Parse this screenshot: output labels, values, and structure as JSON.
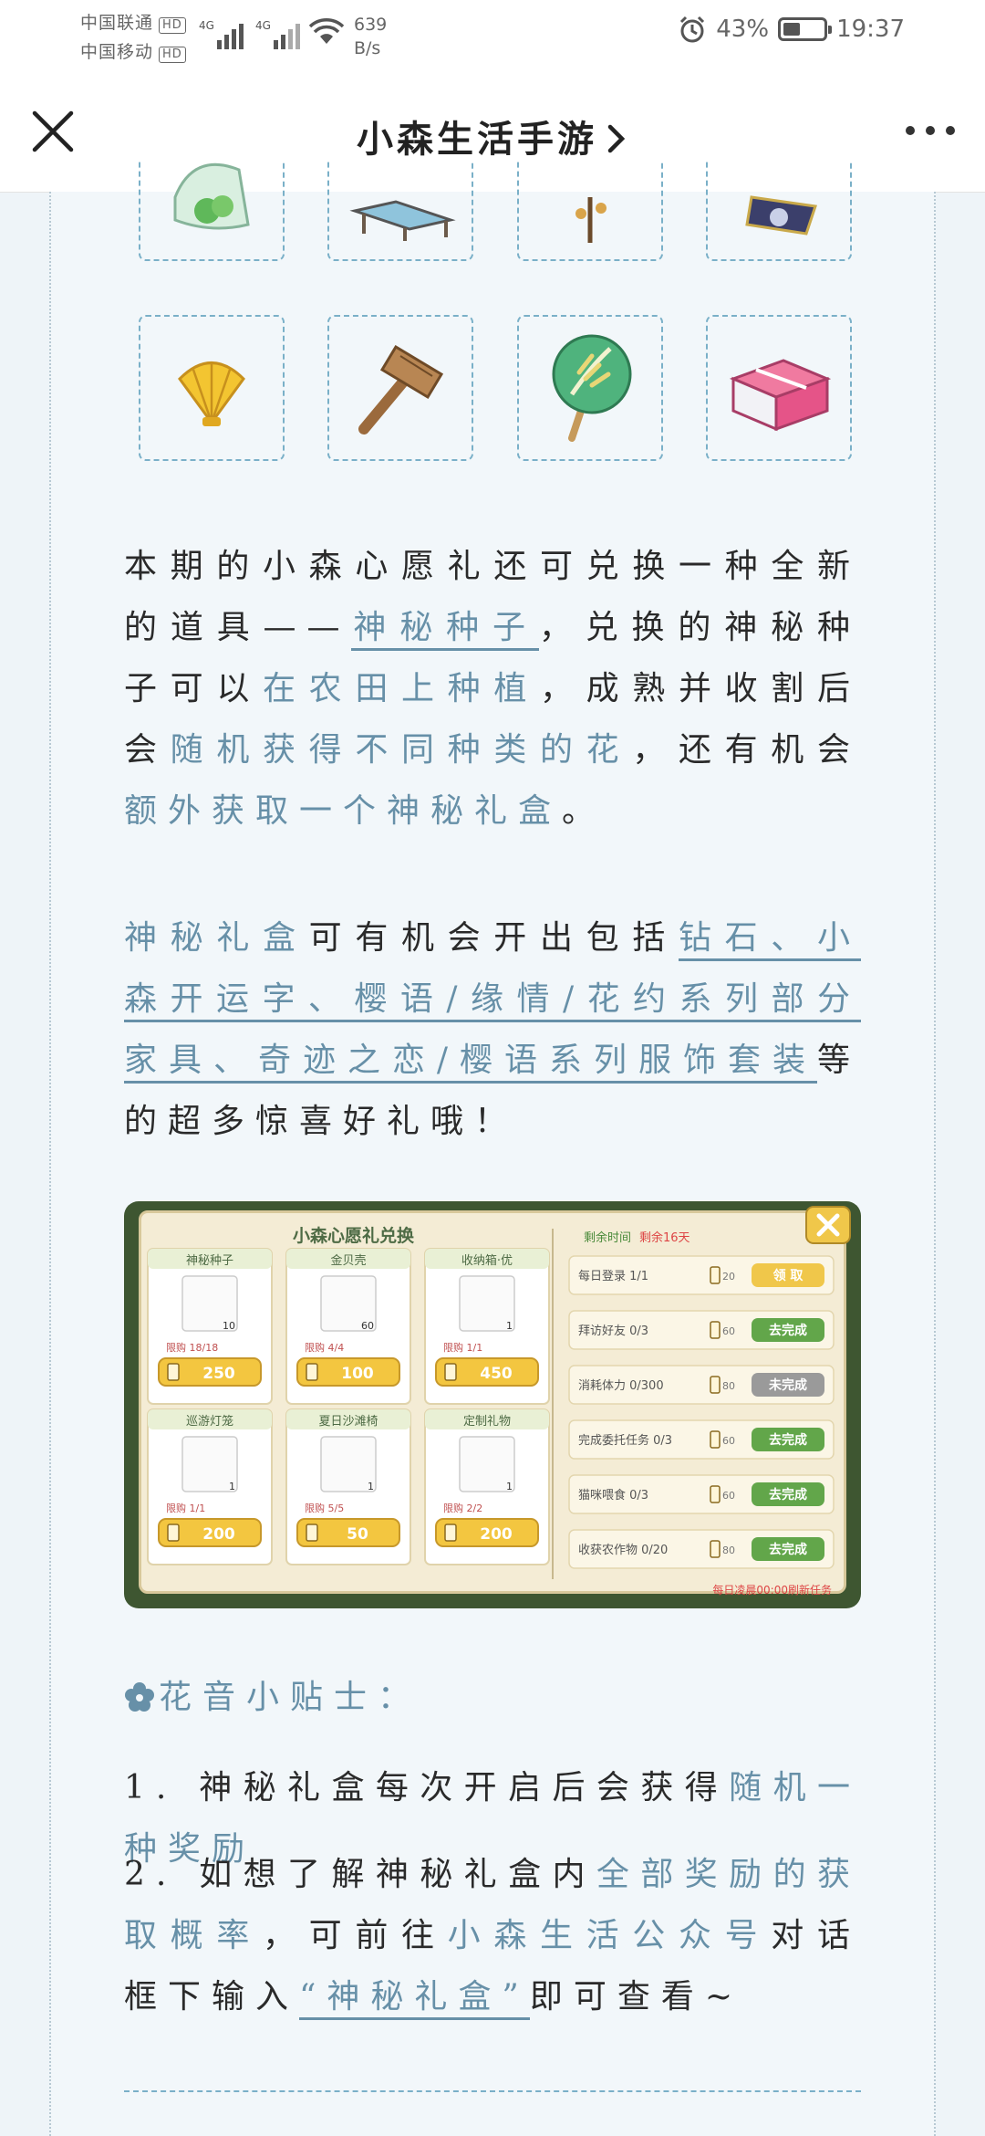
{
  "status": {
    "carrier1": "中国联通",
    "carrier2": "中国移动",
    "hd": "HD",
    "net_speed_value": "639",
    "net_speed_unit": "B/s",
    "signal_label": "4G",
    "battery_text": "43%",
    "battery_level": 0.43,
    "time": "19:37"
  },
  "nav": {
    "title": "小森生活手游",
    "close_icon": "close-icon",
    "more_icon": "more-icon"
  },
  "article": {
    "p1": {
      "s1": "本期的小森心愿礼还可兑换一种全新的道具——",
      "s2": "神秘种子",
      "s3": "，兑换的神秘种子可以",
      "s4": "在农田上种植",
      "s5": "，成熟并收割后会",
      "s6": "随机获得不同种类的花",
      "s7": "，还有机会",
      "s8": "额外获取一个神秘礼盒",
      "s9": "。"
    },
    "p2": {
      "s1": "神秘礼盒",
      "s2": "可有机会开出包括",
      "s3": "钻石、小森开运字、樱语/缘情/花约系列部分家具、奇迹之恋/樱语系列服饰套装",
      "s4": "等的超多惊喜好礼哦！"
    },
    "tips_title": "花音小贴士：",
    "tip1": {
      "s1": "1. 神秘礼盒每次开启后会获得",
      "s2": "随机一种奖励"
    },
    "tip2": {
      "s1": "2. 如想了解神秘礼盒内",
      "s2": "全部奖励的获取概率",
      "s3": "，可前往",
      "s4": "小森生活公众号",
      "s5": "对话框下输入",
      "s6": "“神秘礼盒”",
      "s7": "即可查看~"
    }
  },
  "game": {
    "title": "小森心愿礼兑换",
    "time_label": "剩余时间",
    "time_value": "剩余16天",
    "footer": "每日凌晨00:00刷新任务",
    "limit_label": "限购",
    "cards": [
      {
        "name": "神秘种子",
        "limit": "18/18",
        "price": "250",
        "count": "10"
      },
      {
        "name": "金贝壳",
        "limit": "4/4",
        "price": "100",
        "count": "60"
      },
      {
        "name": "收纳箱·优",
        "limit": "1/1",
        "price": "450",
        "count": "1"
      },
      {
        "name": "巡游灯笼",
        "limit": "1/1",
        "price": "200",
        "count": "1"
      },
      {
        "name": "夏日沙滩椅",
        "limit": "5/5",
        "price": "50",
        "count": "1"
      },
      {
        "name": "定制礼物",
        "limit": "2/2",
        "price": "200",
        "count": "1"
      }
    ],
    "tasks": [
      {
        "name": "每日登录",
        "progress": "1/1",
        "reward": "20",
        "button": "领 取",
        "state": "claim"
      },
      {
        "name": "拜访好友",
        "progress": "0/3",
        "reward": "60",
        "button": "去完成",
        "state": "go"
      },
      {
        "name": "消耗体力",
        "progress": "0/300",
        "reward": "80",
        "button": "未完成",
        "state": "locked"
      },
      {
        "name": "完成委托任务",
        "progress": "0/3",
        "reward": "60",
        "button": "去完成",
        "state": "go"
      },
      {
        "name": "猫咪喂食",
        "progress": "0/3",
        "reward": "60",
        "button": "去完成",
        "state": "go"
      },
      {
        "name": "收获农作物",
        "progress": "0/20",
        "reward": "80",
        "button": "去完成",
        "state": "go"
      }
    ]
  },
  "colors": {
    "accent": "#6790a8",
    "text": "#2a2a2a",
    "background": "#f2f7fa",
    "dashed_border": "#7ab0c8",
    "game_green": "#62a64a"
  }
}
